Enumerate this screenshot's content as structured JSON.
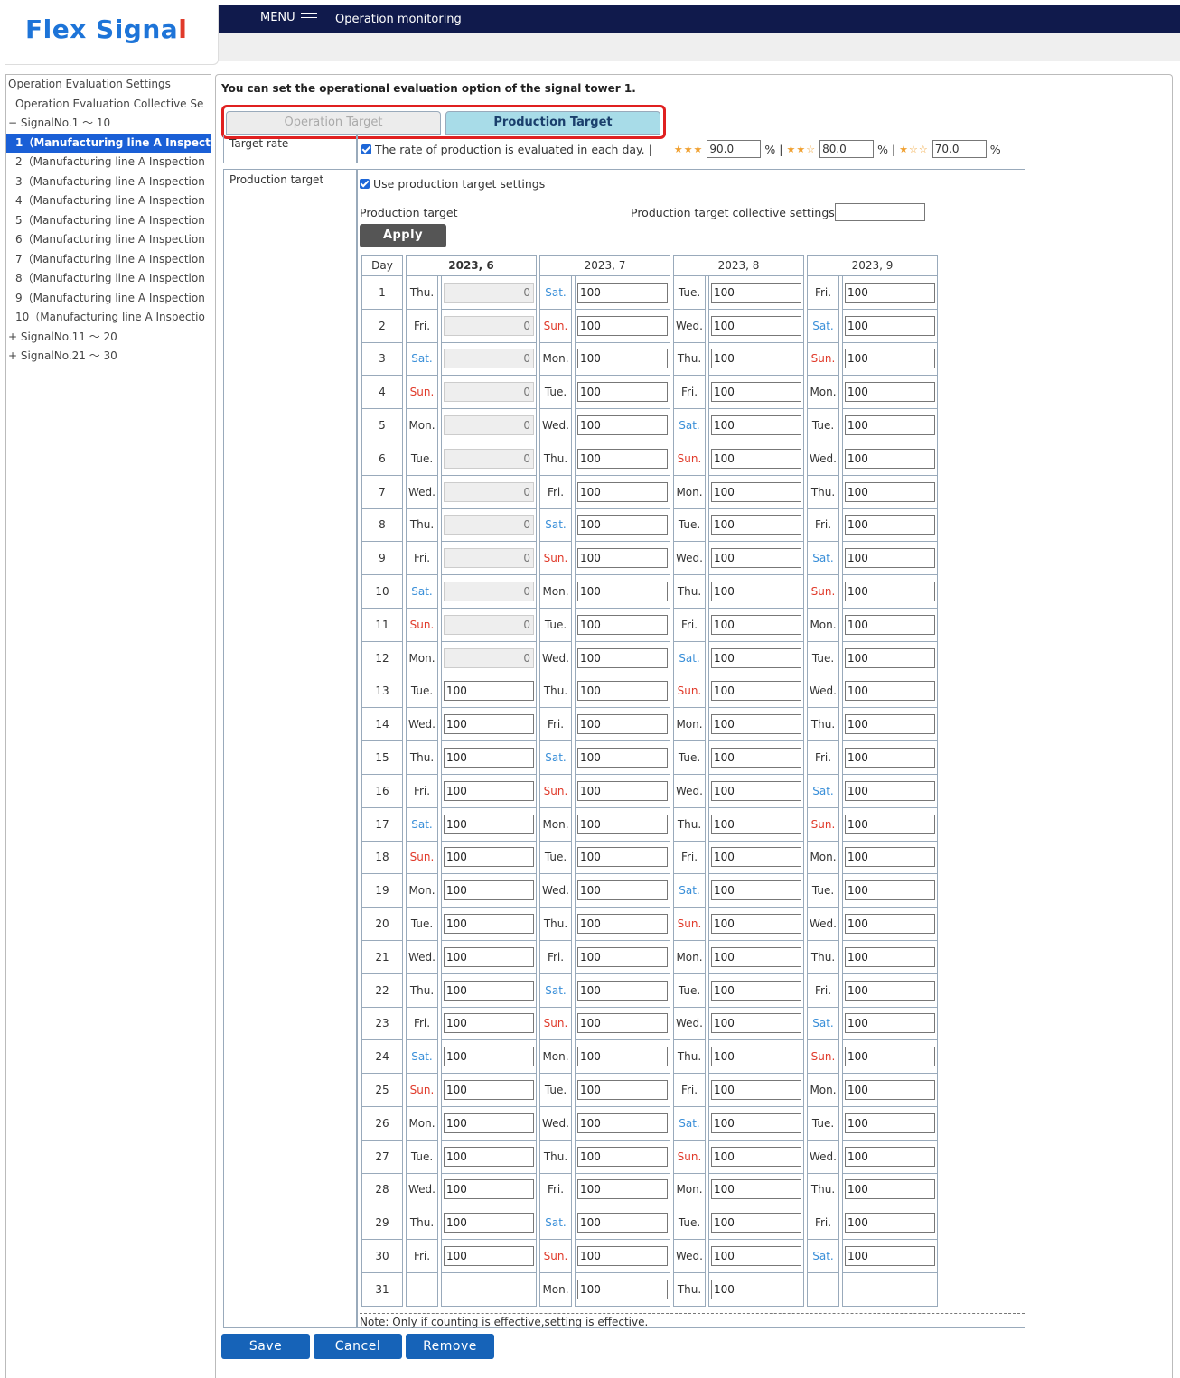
{
  "app": {
    "logo_main": "Flex Sig",
    "logo_n": "n",
    "logo_a": "a",
    "logo_bang": "l"
  },
  "header": {
    "menu_label": "MENU",
    "page_title": "Operation monitoring"
  },
  "sidebar": {
    "items": [
      {
        "label": "Operation Evaluation Settings",
        "indent": false,
        "selected": false
      },
      {
        "label": "Operation Evaluation Collective Se",
        "indent": true,
        "selected": false
      },
      {
        "label": "− SignalNo.1 ～ 10",
        "indent": false,
        "selected": false
      },
      {
        "label": "1（Manufacturing line A Inspect",
        "indent": true,
        "selected": true
      },
      {
        "label": "2（Manufacturing line A Inspection",
        "indent": true,
        "selected": false
      },
      {
        "label": "3（Manufacturing line A Inspection",
        "indent": true,
        "selected": false
      },
      {
        "label": "4（Manufacturing line A Inspection",
        "indent": true,
        "selected": false
      },
      {
        "label": "5（Manufacturing line A Inspection",
        "indent": true,
        "selected": false
      },
      {
        "label": "6（Manufacturing line A Inspection",
        "indent": true,
        "selected": false
      },
      {
        "label": "7（Manufacturing line A Inspection",
        "indent": true,
        "selected": false
      },
      {
        "label": "8（Manufacturing line A Inspection",
        "indent": true,
        "selected": false
      },
      {
        "label": "9（Manufacturing line A Inspection",
        "indent": true,
        "selected": false
      },
      {
        "label": "10（Manufacturing line A Inspectio",
        "indent": true,
        "selected": false
      },
      {
        "label": "+ SignalNo.11 ～ 20",
        "indent": false,
        "selected": false
      },
      {
        "label": "+ SignalNo.21 ～ 30",
        "indent": false,
        "selected": false
      }
    ]
  },
  "main": {
    "intro": "You can set the operational evaluation option of the signal tower 1.",
    "tabs": {
      "operation": "Operation Target",
      "production": "Production Target"
    },
    "target_rate": {
      "label": "Target rate",
      "text": "The rate of production is evaluated in each day. |",
      "stars3": "★★★",
      "stars2": "★★☆",
      "stars1": "★☆☆",
      "v3": "90.0",
      "v2": "80.0",
      "v1": "70.0",
      "sep": "% |",
      "pct": "%"
    },
    "production": {
      "label": "Production target",
      "use_label": "Use production target settings",
      "sub_label": "Production target",
      "collective_label": "Production target collective settings",
      "collective_value": "",
      "apply": "Apply"
    },
    "calendar": {
      "day_header": "Day",
      "months": [
        "2023, 6",
        "2023, 7",
        "2023, 8",
        "2023, 9"
      ],
      "weekday_names": [
        "Sun.",
        "Mon.",
        "Tue.",
        "Wed.",
        "Thu.",
        "Fri.",
        "Sat."
      ],
      "month_first_weekday": [
        4,
        6,
        2,
        5
      ],
      "month_days": [
        30,
        31,
        31,
        30
      ],
      "june_disabled_through": 12,
      "disabled_value": "0",
      "value": "100"
    },
    "note": "Note: Only if counting is effective,setting is effective.",
    "buttons": {
      "save": "Save",
      "cancel": "Cancel",
      "remove": "Remove"
    }
  }
}
